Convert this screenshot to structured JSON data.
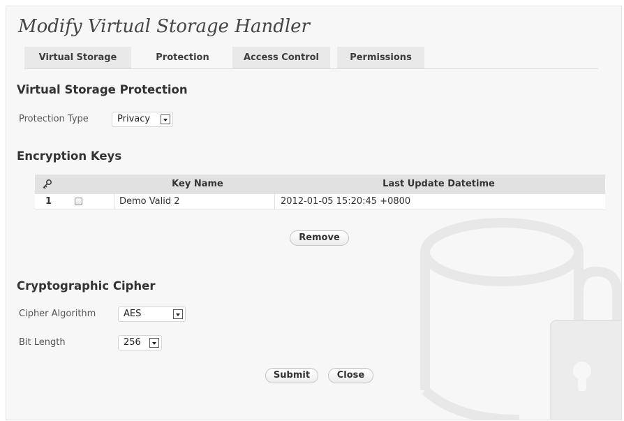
{
  "page": {
    "title": "Modify Virtual Storage Handler",
    "tabs": [
      {
        "label": "Virtual Storage"
      },
      {
        "label": "Protection"
      },
      {
        "label": "Access Control"
      },
      {
        "label": "Permissions"
      }
    ],
    "active_tab": "Protection"
  },
  "protection": {
    "heading": "Virtual Storage Protection",
    "type_label": "Protection Type",
    "type_value": "Privacy"
  },
  "keys": {
    "heading": "Encryption Keys",
    "icon": "key-icon",
    "columns": {
      "name": "Key Name",
      "updated": "Last Update Datetime"
    },
    "rows": [
      {
        "index": "1",
        "name": "Demo Valid 2",
        "updated": "2012-01-05 15:20:45 +0800",
        "checked": false
      }
    ],
    "remove_label": "Remove"
  },
  "cipher": {
    "heading": "Cryptographic Cipher",
    "algorithm_label": "Cipher Algorithm",
    "algorithm_value": "AES",
    "bitlength_label": "Bit Length",
    "bitlength_value": "256"
  },
  "actions": {
    "submit_label": "Submit",
    "close_label": "Close"
  },
  "decoration": {
    "watermark_icon": "storage-lock-icon"
  }
}
